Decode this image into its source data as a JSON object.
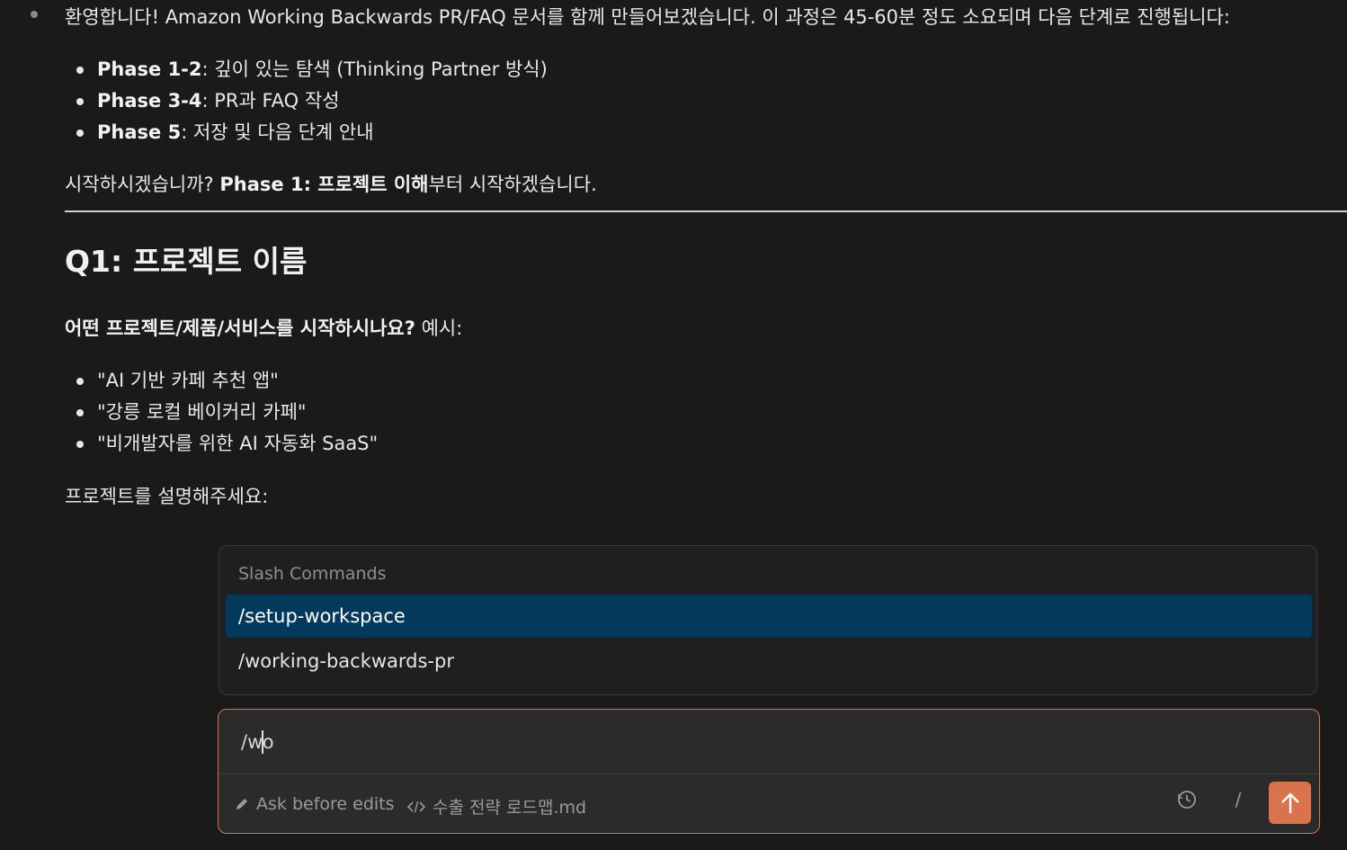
{
  "intro": {
    "text": "환영합니다! Amazon Working Backwards PR/FAQ 문서를 함께 만들어보겠습니다. 이 과정은 45-60분 정도 소요되며 다음 단계로 진행됩니다:"
  },
  "phases": [
    {
      "label": "Phase 1-2",
      "desc": ": 깊이 있는 탐색 (Thinking Partner 방식)"
    },
    {
      "label": "Phase 3-4",
      "desc": ": PR과 FAQ 작성"
    },
    {
      "label": "Phase 5",
      "desc": ": 저장 및 다음 단계 안내"
    }
  ],
  "start_prompt": {
    "prefix": "시작하시겠습니까? ",
    "bold": "Phase 1: 프로젝트 이해",
    "suffix": "부터 시작하겠습니다."
  },
  "question": {
    "heading": "Q1: 프로젝트 이름",
    "bold": "어떤 프로젝트/제품/서비스를 시작하시나요?",
    "suffix": " 예시:",
    "examples": [
      "\"AI 기반 카페 추천 앱\"",
      "\"강릉 로컬 베이커리 카페\"",
      "\"비개발자를 위한 AI 자동화 SaaS\""
    ],
    "request": "프로젝트를 설명해주세요:"
  },
  "slash_commands": {
    "title": "Slash Commands",
    "items": [
      {
        "label": "/setup-workspace",
        "selected": true
      },
      {
        "label": "/working-backwards-pr",
        "selected": false
      }
    ]
  },
  "composer": {
    "input_before_caret": "/w",
    "input_after_caret": "o",
    "mode_label": "Ask before edits",
    "file_label": "수출 전략 로드맵.md",
    "slash_label": "/"
  },
  "colors": {
    "background": "#1a1a1a",
    "accent": "#d9734e",
    "selection": "#04395e"
  }
}
